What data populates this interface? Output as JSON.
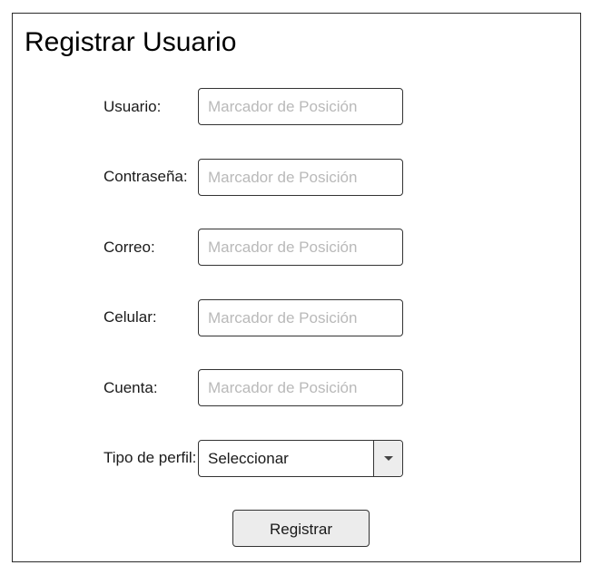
{
  "form": {
    "title": "Registrar Usuario",
    "fields": [
      {
        "label": "Usuario:",
        "placeholder": "Marcador de Posición"
      },
      {
        "label": "Contraseña:",
        "placeholder": "Marcador de Posición"
      },
      {
        "label": "Correo:",
        "placeholder": "Marcador de Posición"
      },
      {
        "label": "Celular:",
        "placeholder": "Marcador de Posición"
      },
      {
        "label": "Cuenta:",
        "placeholder": "Marcador de Posición"
      }
    ],
    "profile": {
      "label": "Tipo de perfil:",
      "selected": "Seleccionar",
      "icon": "chevron-down-icon"
    },
    "submit_label": "Registrar"
  }
}
